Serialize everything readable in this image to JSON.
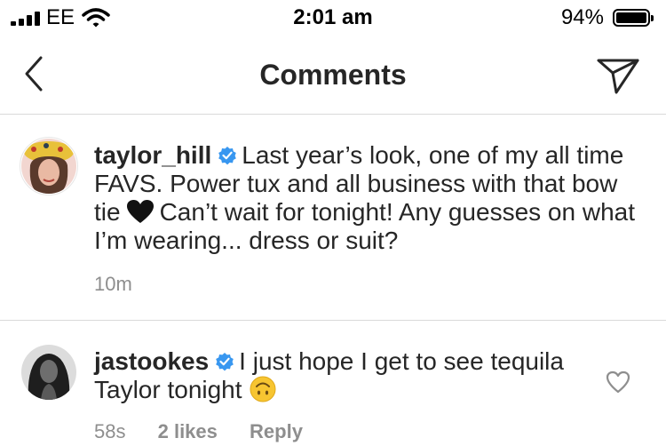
{
  "status_bar": {
    "carrier": "EE",
    "time": "2:01 am",
    "battery_percent": "94%",
    "battery_level": 0.94,
    "signal_bars": 4
  },
  "nav": {
    "title": "Comments",
    "back_icon": "chevron-left-icon",
    "send_icon": "paper-plane-icon"
  },
  "caption": {
    "username": "taylor_hill",
    "verified": true,
    "text_before_emoji": "Last year’s look, one of my all time FAVS. Power tux and all business with that bow tie",
    "emoji": "black-heart",
    "text_after_emoji": "Can’t wait for tonight! Any guesses on what I’m wearing... dress or suit?",
    "time": "10m"
  },
  "comments": [
    {
      "username": "jastookes",
      "verified": true,
      "text": "I just hope I get to see tequila Taylor tonight",
      "emoji": "upside-down-face",
      "time": "58s",
      "likes": "2 likes",
      "reply_label": "Reply",
      "like_icon": "heart-outline-icon"
    }
  ],
  "colors": {
    "verified_blue": "#3897f0",
    "secondary_text": "#8e8e8e",
    "primary_text": "#262626",
    "divider": "#d9d9d9"
  }
}
